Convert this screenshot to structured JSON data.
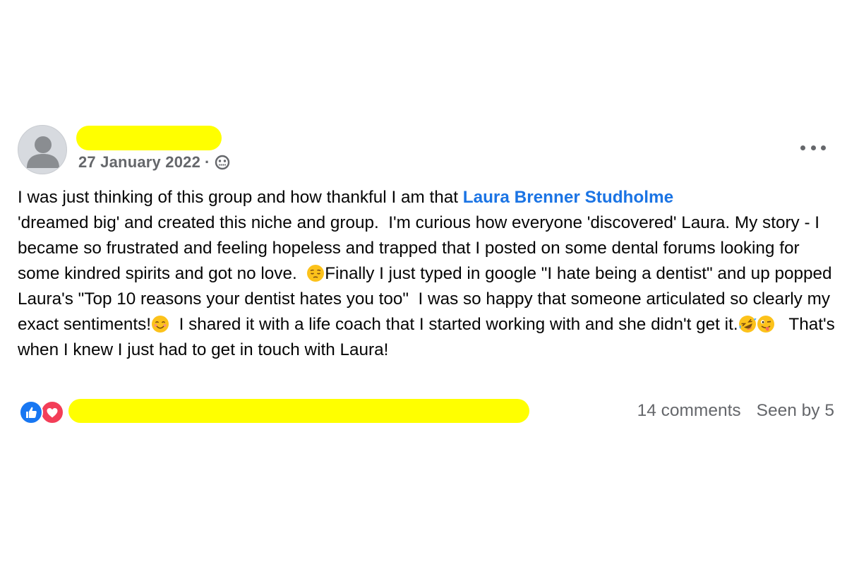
{
  "post": {
    "timestamp": "27 January 2022",
    "separator": "·",
    "privacy_icon": "group-privacy-icon",
    "more_icon": "more-options-icon",
    "content": {
      "part1": "I was just thinking of this group and how thankful I am that ",
      "mention": "Laura Brenner Studholme",
      "part2": "\n'dreamed big' and created this niche and group.  I'm curious how everyone 'discovered' Laura. My story - I became so frustrated and feeling hopeless and trapped that I posted on some dental forums looking for some kindred spirits and got no love.  ",
      "emoji1": "pensive-face",
      "part3": "Finally I just typed in google \"I hate being a dentist\" and up popped Laura's \"Top 10 reasons your dentist hates you too\"  I was so happy that someone articulated so clearly my exact sentiments!",
      "emoji2": "smiling-face",
      "part4": "  I shared it with a life coach that I started working with and she didn't get it.",
      "emoji3": "rolling-laughing-face",
      "emoji4": "winking-tongue-face",
      "part5": "   That's when I knew I just had to get in touch with Laura!"
    },
    "reactions": [
      "like-icon",
      "love-icon"
    ],
    "comments": "14 comments",
    "seen_by": "Seen by 5"
  }
}
